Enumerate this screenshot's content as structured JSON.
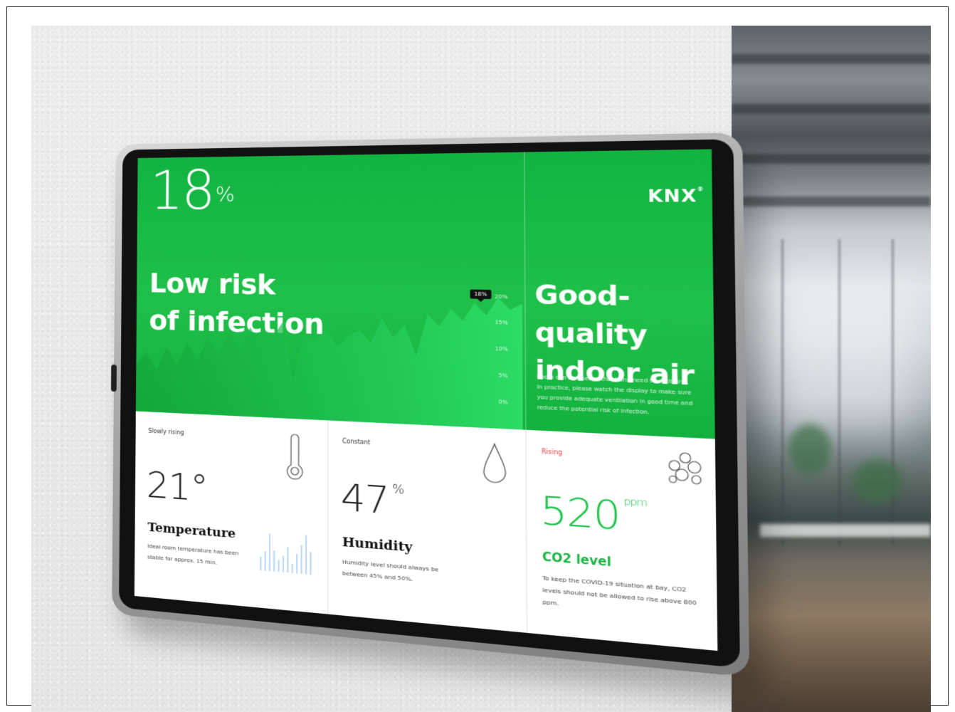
{
  "risk": {
    "percent": "18",
    "percent_unit": "%",
    "title_line1": "Low risk",
    "title_line2": "of infection"
  },
  "chart_data": {
    "type": "area",
    "y_ticks": [
      "20%",
      "15%",
      "10%",
      "5%",
      "0%"
    ],
    "ylim": [
      0,
      20
    ],
    "current_marker": "18%",
    "values": [
      6,
      8,
      5,
      9,
      6,
      10,
      7,
      11,
      8,
      12,
      9,
      13,
      10,
      11,
      14,
      4,
      12,
      11,
      13,
      10,
      12,
      13,
      11,
      15,
      12,
      14,
      9,
      16,
      14,
      17,
      15,
      18,
      16,
      19,
      17,
      18
    ]
  },
  "air": {
    "title_line1": "Good-quality",
    "title_line2": "indoor air",
    "description": "Room can be used without any need to air it first. In practice, please watch the display to make sure you provide adequate ventilation in good time and reduce the potential risk of infection."
  },
  "brand": {
    "name": "KNX",
    "reg": "®"
  },
  "cards": [
    {
      "status": "Slowly rising",
      "value": "21°",
      "unit": "",
      "label": "Temperature",
      "description": "Ideal room temperature has been stable for approx. 15 min.",
      "icon": "thermometer-icon"
    },
    {
      "status": "Constant",
      "value": "47",
      "unit": "%",
      "label": "Humidity",
      "description": "Humidity level should always be between 45% and 50%.",
      "icon": "droplet-icon"
    },
    {
      "status": "Rising",
      "value": "520",
      "unit": "ppm",
      "label": "CO2 level",
      "description": "To keep the COVID-19 situation at bay, CO2 levels should not be allowed to rise above 800 ppm.",
      "icon": "bubbles-icon"
    }
  ],
  "colors": {
    "screen_green": "#1fc049",
    "accent_green": "#1cc24a",
    "status_red": "#e23a3a"
  }
}
